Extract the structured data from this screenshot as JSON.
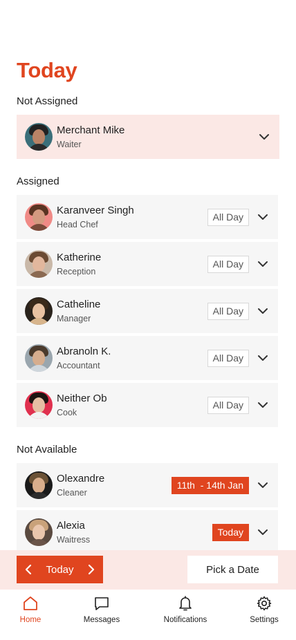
{
  "title": "Today",
  "sections": {
    "not_assigned": "Not Assigned",
    "assigned": "Assigned",
    "not_available": "Not Available"
  },
  "not_assigned": [
    {
      "name": "Merchant Mike",
      "role": "Waiter"
    }
  ],
  "assigned": [
    {
      "name": "Karanveer Singh",
      "role": "Head Chef",
      "tag": "All Day"
    },
    {
      "name": "Katherine",
      "role": "Reception",
      "tag": "All Day"
    },
    {
      "name": "Catheline",
      "role": "Manager",
      "tag": "All Day"
    },
    {
      "name": "Abranoln K.",
      "role": "Accountant",
      "tag": "All Day"
    },
    {
      "name": "Neither Ob",
      "role": "Cook",
      "tag": "All Day"
    }
  ],
  "not_available": [
    {
      "name": "Olexandre",
      "role": "Cleaner",
      "tag": "11th  - 14th Jan"
    },
    {
      "name": "Alexia",
      "role": "Waitress",
      "tag": "Today"
    }
  ],
  "date_nav": {
    "label": "Today",
    "pick_date": "Pick a Date"
  },
  "tabs": [
    {
      "label": "Home",
      "icon": "home-icon",
      "active": true
    },
    {
      "label": "Messages",
      "icon": "message-icon"
    },
    {
      "label": "Notifications",
      "icon": "bell-icon"
    },
    {
      "label": "Settings",
      "icon": "gear-icon"
    }
  ],
  "colors": {
    "accent": "#e0451f",
    "highlight_row": "#fbe8e5",
    "row": "#f6f6f6"
  }
}
